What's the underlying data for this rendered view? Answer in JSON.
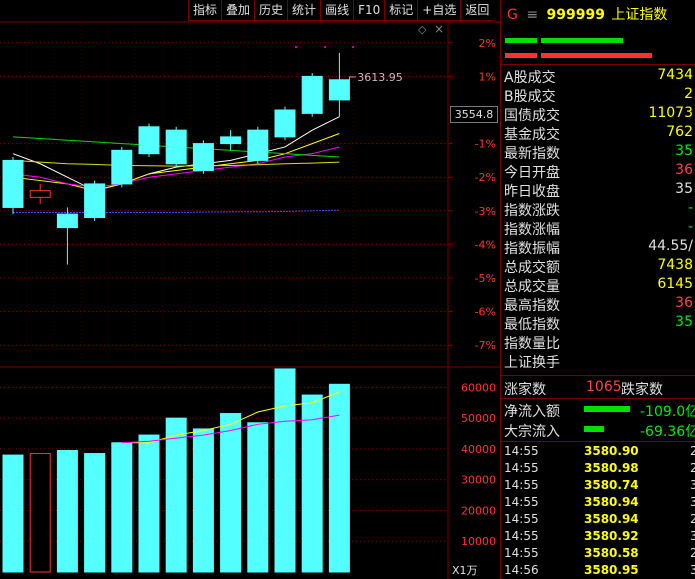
{
  "toolbar": {
    "buttons": [
      "指标",
      "叠加",
      "历史",
      "统计",
      "画线",
      "F10",
      "标记",
      "+自选",
      "返回"
    ]
  },
  "chart": {
    "right_axis_labels": [
      "2%",
      "1%",
      "-1%",
      "-2%",
      "-3%",
      "-4%",
      "-5%",
      "-6%",
      "-7%"
    ],
    "current_price_box": "3554.8",
    "high_annotation": "3613.95",
    "volume_axis_labels": [
      "60000",
      "50000",
      "40000",
      "30000",
      "20000",
      "10000"
    ],
    "volume_unit": "X1万"
  },
  "chart_data": {
    "type": "candlestick",
    "candles": [
      {
        "o": -1.5,
        "c": -2.9,
        "h": -1.4,
        "l": -3.1
      },
      {
        "o": -2.6,
        "c": -2.4,
        "h": -2.2,
        "l": -2.8
      },
      {
        "o": -3.1,
        "c": -3.5,
        "h": -2.9,
        "l": -4.6
      },
      {
        "o": -2.2,
        "c": -3.2,
        "h": -2.1,
        "l": -3.3
      },
      {
        "o": -1.2,
        "c": -2.2,
        "h": -1.1,
        "l": -2.3
      },
      {
        "o": -0.5,
        "c": -1.3,
        "h": -0.4,
        "l": -1.4
      },
      {
        "o": -0.6,
        "c": -1.6,
        "h": -0.5,
        "l": -1.7
      },
      {
        "o": -1.0,
        "c": -1.8,
        "h": -0.9,
        "l": -1.9
      },
      {
        "o": -0.8,
        "c": -1.0,
        "h": -0.6,
        "l": -1.2
      },
      {
        "o": -0.6,
        "c": -1.5,
        "h": -0.5,
        "l": -1.6
      },
      {
        "o": 0.0,
        "c": -0.8,
        "h": 0.1,
        "l": -0.9
      },
      {
        "o": 1.0,
        "c": -0.1,
        "h": 1.1,
        "l": -0.2
      },
      {
        "o": 0.9,
        "c": 0.3,
        "h": 1.7,
        "l": -0.2
      }
    ],
    "ma": [
      {
        "name": "ma-white",
        "values": [
          -1.3,
          -1.6,
          -2.0,
          -2.4,
          -2.2,
          -1.9,
          -1.7,
          -1.6,
          -1.5,
          -1.3,
          -1.1,
          -0.6,
          -0.2
        ]
      },
      {
        "name": "ma-yellow",
        "values": [
          -2.0,
          -2.1,
          -2.2,
          -2.4,
          -2.2,
          -1.9,
          -1.8,
          -1.7,
          -1.6,
          -1.5,
          -1.3,
          -1.0,
          -0.7
        ]
      },
      {
        "name": "ma-magenta",
        "values": [
          -1.9,
          -2.0,
          -2.2,
          -2.3,
          -2.2,
          -2.0,
          -1.9,
          -1.8,
          -1.7,
          -1.6,
          -1.4,
          -1.3,
          -1.1
        ]
      },
      {
        "name": "ma-green",
        "values": [
          -0.8,
          -0.85,
          -0.9,
          -0.95,
          -1.0,
          -1.05,
          -1.1,
          -1.15,
          -1.2,
          -1.25,
          -1.3,
          -1.35,
          -1.4
        ]
      },
      {
        "name": "ma-yellow-flat",
        "values": [
          -1.5,
          -1.55,
          -1.6,
          -1.62,
          -1.65,
          -1.66,
          -1.67,
          -1.66,
          -1.65,
          -1.63,
          -1.6,
          -1.58,
          -1.55
        ]
      },
      {
        "name": "ma-blue",
        "values": [
          -3.05,
          -3.05,
          -3.05,
          -3.05,
          -3.05,
          -3.05,
          -3.05,
          -3.04,
          -3.03,
          -3.03,
          -3.02,
          -3.0,
          -2.98
        ]
      }
    ],
    "volume": [
      38000,
      38500,
      39500,
      38500,
      42000,
      44500,
      50000,
      46500,
      51500,
      48500,
      66000,
      57500,
      61000
    ],
    "volume_ma": [
      {
        "name": "vol-ma-yellow",
        "values": [
          null,
          null,
          null,
          null,
          42000,
          42000,
          44500,
          46000,
          48000,
          52000,
          54000,
          55000,
          58500
        ]
      },
      {
        "name": "vol-ma-magenta",
        "values": [
          null,
          null,
          null,
          null,
          42000,
          42500,
          43500,
          44500,
          46000,
          48000,
          49000,
          49500,
          51000
        ]
      }
    ],
    "y_range_pct": [
      -7.5,
      2.5
    ],
    "vol_range": [
      0,
      65000
    ]
  },
  "side": {
    "title_g": "G",
    "title_icon": "≡",
    "code": "999999",
    "name": "上证指数",
    "stats": [
      {
        "label": "A股成交",
        "value": "7434",
        "color": "#ffff00"
      },
      {
        "label": "B股成交",
        "value": "2",
        "color": "#ffff00"
      },
      {
        "label": "国债成交",
        "value": "11073",
        "color": "#ffff00"
      },
      {
        "label": "基金成交",
        "value": "762",
        "color": "#ffff00"
      },
      {
        "label": "最新指数",
        "value": "35",
        "color": "#00ee00"
      },
      {
        "label": "今日开盘",
        "value": "36",
        "color": "#ff4444"
      },
      {
        "label": "昨日收盘",
        "value": "35",
        "color": "#e0e0e0"
      },
      {
        "label": "指数涨跌",
        "value": "-",
        "color": "#00ee00"
      },
      {
        "label": "指数涨幅",
        "value": "-",
        "color": "#00ee00"
      },
      {
        "label": "指数振幅",
        "value": "44.55/",
        "color": "#e0e0e0"
      },
      {
        "label": "总成交额",
        "value": "7438",
        "color": "#ffff00"
      },
      {
        "label": "总成交量",
        "value": "6145",
        "color": "#ffff00"
      },
      {
        "label": "最高指数",
        "value": "36",
        "color": "#ff4444"
      },
      {
        "label": "最低指数",
        "value": "35",
        "color": "#00ee00"
      },
      {
        "label": "指数量比",
        "value": "",
        "color": "#e0e0e0"
      },
      {
        "label": "上证换手",
        "value": "",
        "color": "#e0e0e0"
      }
    ],
    "up_label": "涨家数",
    "up_count": "1065",
    "down_label": "跌家数",
    "net_inflow_label": "净流入额",
    "net_inflow_value": "-109.0亿",
    "block_inflow_label": "大宗流入",
    "block_inflow_value": "-69.36亿",
    "ticks": [
      {
        "time": "14:55",
        "price": "3580.90",
        "vol": "2"
      },
      {
        "time": "14:55",
        "price": "3580.98",
        "vol": "2"
      },
      {
        "time": "14:55",
        "price": "3580.74",
        "vol": "3"
      },
      {
        "time": "14:55",
        "price": "3580.94",
        "vol": "3"
      },
      {
        "time": "14:55",
        "price": "3580.94",
        "vol": "2"
      },
      {
        "time": "14:55",
        "price": "3580.92",
        "vol": "3"
      },
      {
        "time": "14:55",
        "price": "3580.58",
        "vol": "2"
      },
      {
        "time": "14:56",
        "price": "3580.95",
        "vol": "3"
      }
    ]
  }
}
